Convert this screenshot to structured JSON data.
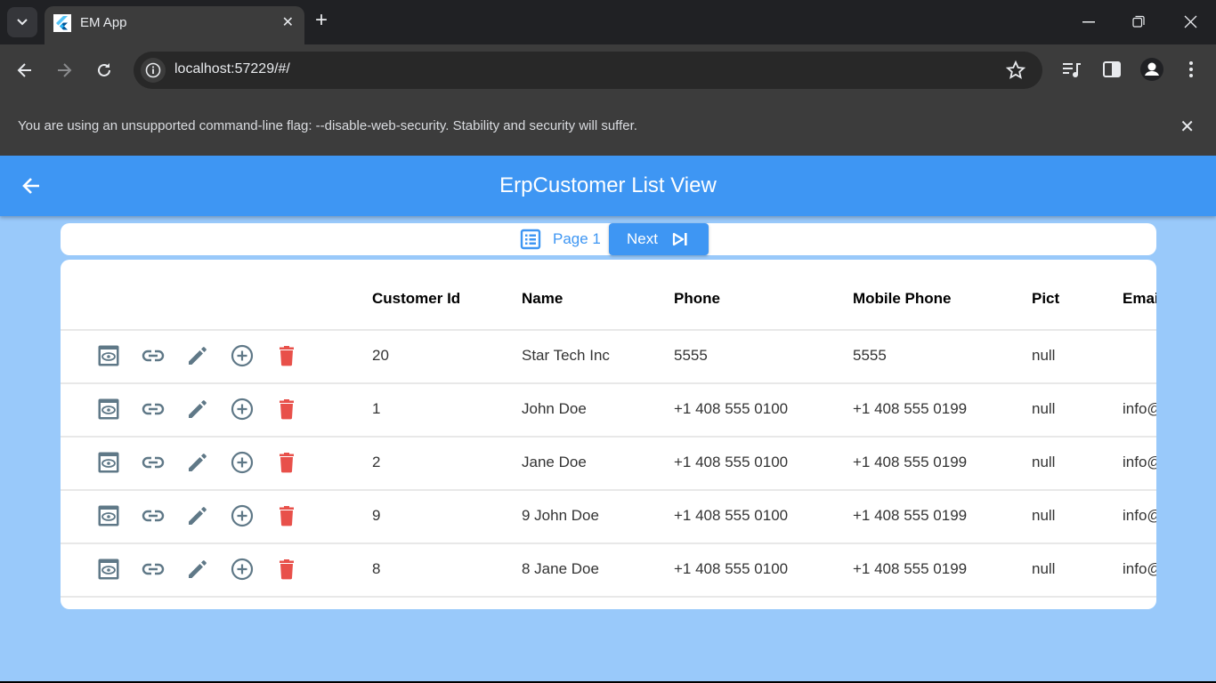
{
  "browser": {
    "tab_title": "EM App",
    "url": "localhost:57229/#/",
    "infobar_message": "You are using an unsupported command-line flag: --disable-web-security. Stability and security will suffer."
  },
  "app": {
    "title": "ErpCustomer List View",
    "accent_color": "#3e96f3",
    "background_color": "#99c9fa",
    "delete_color": "#e8504a",
    "icon_color": "#5f7887"
  },
  "pager": {
    "page_label": "Page 1",
    "next_label": "Next"
  },
  "table": {
    "columns": [
      "Customer Id",
      "Name",
      "Phone",
      "Mobile Phone",
      "Pict",
      "Emai"
    ],
    "row_actions": [
      "view-icon",
      "link-icon",
      "edit-icon",
      "add-icon",
      "delete-icon"
    ],
    "rows": [
      {
        "customer_id": "20",
        "name": "Star Tech Inc",
        "phone": "5555",
        "mobile_phone": "5555",
        "pict": "null",
        "email": ""
      },
      {
        "customer_id": "1",
        "name": "John Doe",
        "phone": "+1 408 555 0100",
        "mobile_phone": "+1 408 555 0199",
        "pict": "null",
        "email": "info@"
      },
      {
        "customer_id": "2",
        "name": "Jane Doe",
        "phone": "+1 408 555 0100",
        "mobile_phone": "+1 408 555 0199",
        "pict": "null",
        "email": "info@"
      },
      {
        "customer_id": "9",
        "name": "9 John Doe",
        "phone": "+1 408 555 0100",
        "mobile_phone": "+1 408 555 0199",
        "pict": "null",
        "email": "info@"
      },
      {
        "customer_id": "8",
        "name": "8 Jane Doe",
        "phone": "+1 408 555 0100",
        "mobile_phone": "+1 408 555 0199",
        "pict": "null",
        "email": "info@"
      }
    ]
  }
}
